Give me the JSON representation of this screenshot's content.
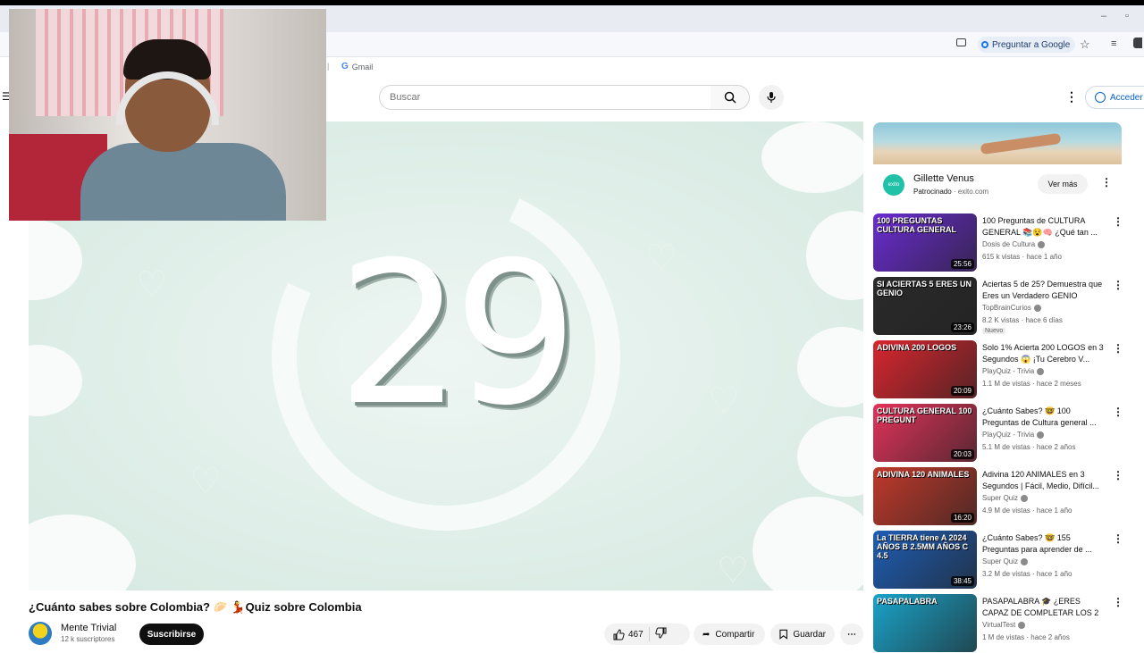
{
  "browser": {
    "ask_google_label": "Preguntar a Google",
    "bookmark_gmail": "Gmail"
  },
  "youtube": {
    "search_placeholder": "Buscar",
    "signin_label": "Acceder"
  },
  "player": {
    "countdown_number": "29"
  },
  "video": {
    "title": "¿Cuánto sabes sobre Colombia? 🥟 💃Quiz sobre Colombia",
    "channel_name": "Mente Trivial",
    "channel_subs": "12 k suscriptores",
    "subscribe_label": "Suscribirse",
    "like_count": "467",
    "share_label": "Compartir",
    "save_label": "Guardar"
  },
  "ad": {
    "title": "Gillette Venus",
    "sponsored_label": "Patrocinado",
    "domain": "exito.com",
    "cta_label": "Ver más"
  },
  "recommendations": [
    {
      "title": "100 Preguntas de CULTURA GENERAL 📚😵🧠 ¿Qué tan ...",
      "channel": "Dosis de Cultura",
      "meta": "615 k vistas · hace 1 año",
      "duration": "25:56",
      "thumb_text": "100 PREGUNTAS CULTURA GENERAL",
      "thumb_color": "#6a2bd0",
      "badge": ""
    },
    {
      "title": "Aciertas 5 de 25? Demuestra que Eres un Verdadero GENIO",
      "channel": "TopBrainCurios",
      "meta": "8.2 K vistas · hace 6 días",
      "duration": "23:26",
      "thumb_text": "SI ACIERTAS 5 ERES UN GENIO",
      "thumb_color": "#2a2a2a",
      "badge": "Nuevo"
    },
    {
      "title": "Solo 1% Acierta 200 LOGOS en 3 Segundos 😱 ¡Tu Cerebro V...",
      "channel": "PlayQuiz - Trivia",
      "meta": "1.1 M de vistas · hace 2 meses",
      "duration": "20:09",
      "thumb_text": "ADIVINA 200 LOGOS",
      "thumb_color": "#d8262e",
      "badge": ""
    },
    {
      "title": "¿Cuánto Sabes? 🤓 100 Preguntas de Cultura general ...",
      "channel": "PlayQuiz - Trivia",
      "meta": "5.1 M de vistas · hace 2 años",
      "duration": "20:03",
      "thumb_text": "CULTURA GENERAL 100 PREGUNT",
      "thumb_color": "#e2335a",
      "badge": ""
    },
    {
      "title": "Adivina 120 ANIMALES en 3 Segundos | Fácil, Medio, Difícil...",
      "channel": "Super Quiz",
      "meta": "4.9 M de vistas · hace 1 año",
      "duration": "16:20",
      "thumb_text": "ADIVINA 120 ANIMALES",
      "thumb_color": "#c0392b",
      "badge": ""
    },
    {
      "title": "¿Cuánto Sabes? 🤓 155 Preguntas para aprender de ...",
      "channel": "Super Quiz",
      "meta": "3.2 M de vistas · hace 1 año",
      "duration": "38:45",
      "thumb_text": "La TIERRA tiene A 2024 AÑOS B 2.5MM AÑOS C 4.5",
      "thumb_color": "#1e5db3",
      "badge": ""
    },
    {
      "title": "PASAPALABRA 🎓 ¿ERES CAPAZ DE COMPLETAR LOS 2 ...",
      "channel": "VirtualTest",
      "meta": "1 M de vistas · hace 2 años",
      "duration": "",
      "thumb_text": "PASAPALABRA",
      "thumb_color": "#1aa3c9",
      "badge": ""
    }
  ]
}
